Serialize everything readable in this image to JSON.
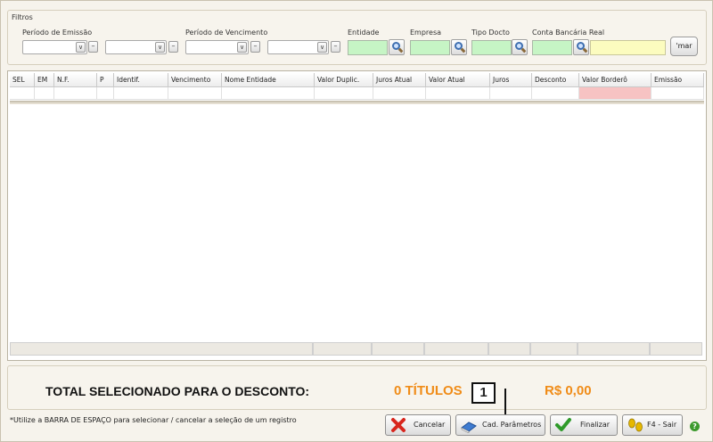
{
  "filters": {
    "title": "Filtros",
    "periodo_emissao": "Período de Emissão",
    "periodo_vencimento": "Período de Vencimento",
    "entidade": "Entidade",
    "empresa": "Empresa",
    "tipo_docto": "Tipo Docto",
    "conta_bancaria": "Conta Bancária Real",
    "confirm_button": "'mar"
  },
  "grid": {
    "columns": [
      "SEL",
      "EM",
      "N.F.",
      "P",
      "Identif.",
      "Vencimento",
      "Nome Entidade",
      "Valor Duplic.",
      "Juros Atual",
      "Valor Atual",
      "Juros",
      "Desconto",
      "Valor Borderô",
      "Emissão"
    ]
  },
  "totals": {
    "label": "TOTAL SELECIONADO PARA O DESCONTO:",
    "count": "0 TÍTULOS",
    "value": "R$ 0,00"
  },
  "callout": "1",
  "hint": "*Utilize a BARRA DE ESPAÇO para selecionar / cancelar a seleção de um registro",
  "buttons": {
    "cancelar": "Cancelar",
    "cad_parametros": "Cad. Parâmetros",
    "finalizar": "Finalizar",
    "sair": "F4 - Sair"
  },
  "colors": {
    "accent": "#f08c18",
    "lookup_field": "#c6f5c5",
    "account_field": "#fcfcbf",
    "borderô_cell": "#f7c3c3"
  },
  "icons": {
    "search": "magnifier-icon",
    "cancel": "red-x-icon",
    "params": "book-icon",
    "finish": "checkmark-icon",
    "exit": "footprints-icon",
    "help": "help-icon"
  }
}
